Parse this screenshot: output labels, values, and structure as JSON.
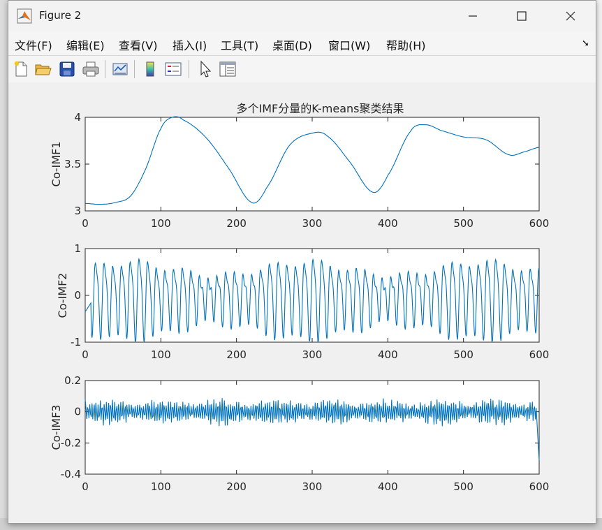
{
  "window": {
    "title": "Figure 2"
  },
  "menu": [
    "文件(F)",
    "编辑(E)",
    "查看(V)",
    "插入(I)",
    "工具(T)",
    "桌面(D)",
    "窗口(W)",
    "帮助(H)"
  ],
  "toolbar_icons": [
    "new-figure-icon",
    "open-file-icon",
    "save-icon",
    "print-icon",
    "link-plot-icon",
    "colorbar-icon",
    "legend-icon",
    "pointer-icon",
    "property-editor-icon"
  ],
  "figure": {
    "title": "多个IMF分量的K-means聚类结果"
  },
  "chart_data": [
    {
      "type": "line",
      "ylabel": "Co-IMF1",
      "xlim": [
        0,
        600
      ],
      "ylim": [
        3,
        4
      ],
      "xticks": [
        "0",
        "100",
        "200",
        "300",
        "400",
        "500",
        "600"
      ],
      "yticks": [
        "3",
        "3.5",
        "4"
      ],
      "color": "#0072BD",
      "x": [
        0,
        20,
        40,
        60,
        80,
        100,
        115,
        130,
        160,
        190,
        220,
        240,
        270,
        300,
        320,
        350,
        380,
        400,
        430,
        450,
        470,
        500,
        530,
        560,
        580,
        600
      ],
      "y": [
        3.08,
        3.07,
        3.09,
        3.16,
        3.45,
        3.88,
        4.0,
        3.97,
        3.78,
        3.45,
        3.09,
        3.25,
        3.7,
        3.83,
        3.8,
        3.52,
        3.2,
        3.38,
        3.85,
        3.92,
        3.86,
        3.79,
        3.76,
        3.6,
        3.63,
        3.68
      ]
    },
    {
      "type": "line",
      "ylabel": "Co-IMF2",
      "xlim": [
        0,
        600
      ],
      "ylim": [
        -1,
        1
      ],
      "xticks": [
        "0",
        "100",
        "200",
        "300",
        "400",
        "500",
        "600"
      ],
      "yticks": [
        "-1",
        "0",
        "1"
      ],
      "color": "#0072BD",
      "period": 11.5,
      "amplitude": 0.78
    },
    {
      "type": "line",
      "ylabel": "Co-IMF3",
      "xlim": [
        0,
        600
      ],
      "ylim": [
        -0.4,
        0.2
      ],
      "xticks": [
        "0",
        "100",
        "200",
        "300",
        "400",
        "500",
        "600"
      ],
      "yticks": [
        "-0.4",
        "-0.2",
        "0",
        "0.2"
      ],
      "color": "#0072BD",
      "amplitude": 0.09,
      "end_value": -0.31
    }
  ]
}
